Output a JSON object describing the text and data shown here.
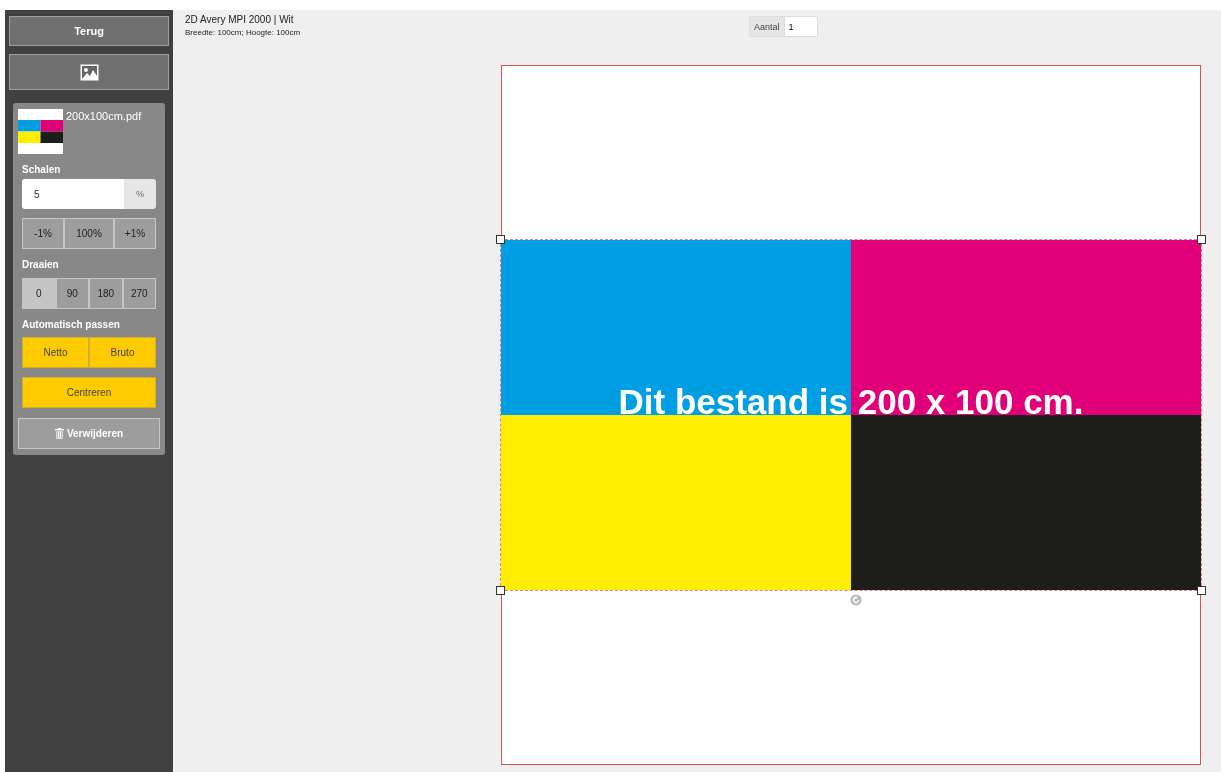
{
  "sidebar": {
    "back_button": "Terug",
    "file": {
      "name": "200x100cm.pdf"
    },
    "scale": {
      "label": "Schalen",
      "value": "5",
      "unit": "%",
      "buttons": [
        "-1%",
        "100%",
        "+1%"
      ]
    },
    "rotate": {
      "label": "Draaien",
      "options": [
        {
          "label": "0",
          "selected": true
        },
        {
          "label": "90",
          "selected": false
        },
        {
          "label": "180",
          "selected": false
        },
        {
          "label": "270",
          "selected": false
        }
      ]
    },
    "autofit": {
      "label": "Automatisch passen",
      "buttons": [
        "Netto",
        "Bruto"
      ],
      "center_button": "Centreren"
    },
    "delete_button": "Verwijderen"
  },
  "header": {
    "title": "2D Avery MPI 2000 | Wit",
    "dimensions": "Breedte: 100cm; Hoogte: 100cm",
    "quantity": {
      "label": "Aantal",
      "value": "1"
    }
  },
  "canvas": {
    "artwork_text": "Dit bestand is 200 x 100 cm."
  }
}
